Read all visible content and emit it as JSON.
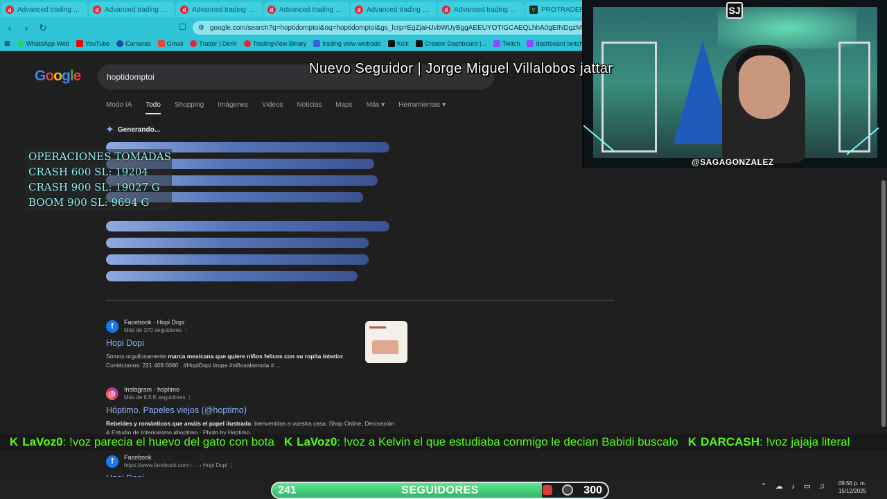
{
  "browser": {
    "tabs": [
      {
        "title": "Advanced trading charts",
        "icon": "deriv-icon"
      },
      {
        "title": "Advanced trading charts",
        "icon": "deriv-icon"
      },
      {
        "title": "Advanced trading charts",
        "icon": "deriv-icon"
      },
      {
        "title": "Advanced trading charts",
        "icon": "deriv-icon"
      },
      {
        "title": "Advanced trading charts",
        "icon": "deriv-icon"
      },
      {
        "title": "Advanced trading charts",
        "icon": "deriv-icon"
      },
      {
        "title": "PROTRADER",
        "icon": "protrader-icon"
      }
    ],
    "url": "google.com/search?q=hoptidomptoi&oq=hoptidomptoi&gs_lcrp=EgZjaHJvbWUyBggAEEUYOTIGCAEQLhhA0gEINDgzMmowajGo",
    "bookmarks": [
      "WhatsApp Web",
      "YouTube",
      "Camaras",
      "Gmail",
      "Trader | Deriv",
      "TradingView Binary",
      "trading view weltrade",
      "Kick",
      "Creator Dashboard |...",
      "Twitch",
      "dashboard twitch"
    ]
  },
  "google": {
    "logo": "Google",
    "query": "hoptidomptoi",
    "tabs": [
      "Modo IA",
      "Todo",
      "Shopping",
      "Imágenes",
      "Videos",
      "Noticias",
      "Maps",
      "Más",
      "Herramientas"
    ],
    "active_tab": "Todo",
    "generating": "Generando...",
    "results": [
      {
        "source": "Facebook · Hopi Dopi",
        "sub": "Más de 370 seguidores",
        "title": "Hopi Dopi",
        "snippet_pre": "Somos orgullosamente ",
        "snippet_bold": "marca mexicana que quiere niños felices con su ropita interior",
        "snippet_post": ". Contáctanos: 221 408 0080 . #HopiDopi #ropa #niñosalamoda # ..."
      },
      {
        "source": "Instagram · hoptimo",
        "sub": "Más de 6.5 K seguidores",
        "title": "Hóptimo. Papeles viejos (@hoptimo)",
        "snippet_pre": "",
        "snippet_bold": "Rebeldes y románticos que amáis el papel ilustrado",
        "snippet_post": ", bienvenidos a vuestra casa. Shop Online, Decoración & Estudio de Interiorismo #hoptimo · Photo by Hóptimo."
      },
      {
        "source": "Facebook",
        "sub": "https://www.facebook.com › ... › Hopi Dopi",
        "title": "Hopi Dopi",
        "snippet_pre": "",
        "snippet_bold": "",
        "snippet_post": ""
      }
    ]
  },
  "overlay": {
    "operations": [
      "OPERACIONES TOMADAS",
      "CRASH 600 SL: 19204",
      "CRASH 900 SL: 19027 G",
      "BOOM 900 SL: 9694 G"
    ],
    "new_follower": "Nuevo Seguidor | Jorge Miguel Villalobos jattar",
    "cam_handle": "@SAGAGONZALEZ",
    "cam_logo": "SJ",
    "ticker": [
      {
        "user": "LaVoz0",
        "msg": ": !voz parecia el huevo del gato con bota"
      },
      {
        "user": "LaVoz0",
        "msg": ": !voz a Kelvin el que estudiaba conmigo le decian Babidi buscalo"
      },
      {
        "user": "DARCASH",
        "msg": ": !voz jajaja literal"
      }
    ],
    "follow_goal": {
      "current": "241",
      "label": "SEGUIDORES",
      "target": "300",
      "progress": 0.8033
    }
  },
  "taskbar": {
    "time": "09:56 p. m.",
    "date": "15/12/2025"
  }
}
